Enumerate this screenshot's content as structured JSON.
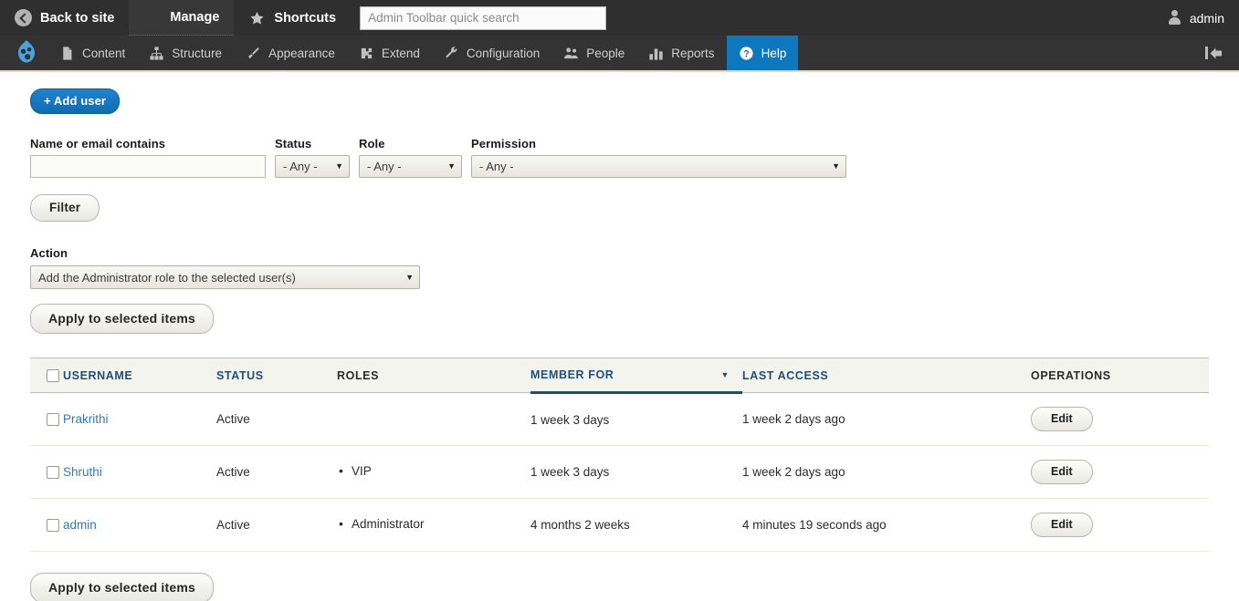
{
  "admin_bar": {
    "back_to_site": "Back to site",
    "manage": "Manage",
    "shortcuts": "Shortcuts",
    "search_placeholder": "Admin Toolbar quick search",
    "search_value": "",
    "user": "admin"
  },
  "menu_bar": {
    "items": [
      {
        "label": "Content",
        "icon": "file-icon"
      },
      {
        "label": "Structure",
        "icon": "sitemap-icon"
      },
      {
        "label": "Appearance",
        "icon": "brush-icon"
      },
      {
        "label": "Extend",
        "icon": "puzzle-icon"
      },
      {
        "label": "Configuration",
        "icon": "wrench-icon"
      },
      {
        "label": "People",
        "icon": "people-icon"
      },
      {
        "label": "Reports",
        "icon": "bar-chart-icon"
      },
      {
        "label": "Help",
        "icon": "question-circle-icon"
      }
    ],
    "active_item": "Help",
    "accent_color": "#0e78bf",
    "background_color": "#333333"
  },
  "page": {
    "add_user_label": "+ Add user",
    "filters": {
      "name_label": "Name or email contains",
      "name_value": "",
      "status_label": "Status",
      "status_value": "- Any -",
      "role_label": "Role",
      "role_value": "- Any -",
      "permission_label": "Permission",
      "permission_value": "- Any -",
      "filter_button": "Filter"
    },
    "action": {
      "label": "Action",
      "value": "Add the Administrator role to the selected user(s)",
      "apply_label": "Apply to selected items"
    },
    "table": {
      "headers": {
        "username": "USERNAME",
        "status": "STATUS",
        "roles": "ROLES",
        "member_for": "MEMBER FOR",
        "last_access": "LAST ACCESS",
        "operations": "OPERATIONS"
      },
      "sorted_column": "MEMBER FOR",
      "sort_direction": "desc",
      "rows": [
        {
          "username": "Prakrithi",
          "status": "Active",
          "roles": [],
          "member_for": "1 week 3 days",
          "last_access": "1 week 2 days ago",
          "operation": "Edit",
          "checked": false
        },
        {
          "username": "Shruthi",
          "status": "Active",
          "roles": [
            "VIP"
          ],
          "member_for": "1 week 3 days",
          "last_access": "1 week 2 days ago",
          "operation": "Edit",
          "checked": false
        },
        {
          "username": "admin",
          "status": "Active",
          "roles": [
            "Administrator"
          ],
          "member_for": "4 months 2 weeks",
          "last_access": "4 minutes 19 seconds ago",
          "operation": "Edit",
          "checked": false
        }
      ]
    },
    "apply_bottom_label": "Apply to selected items"
  }
}
